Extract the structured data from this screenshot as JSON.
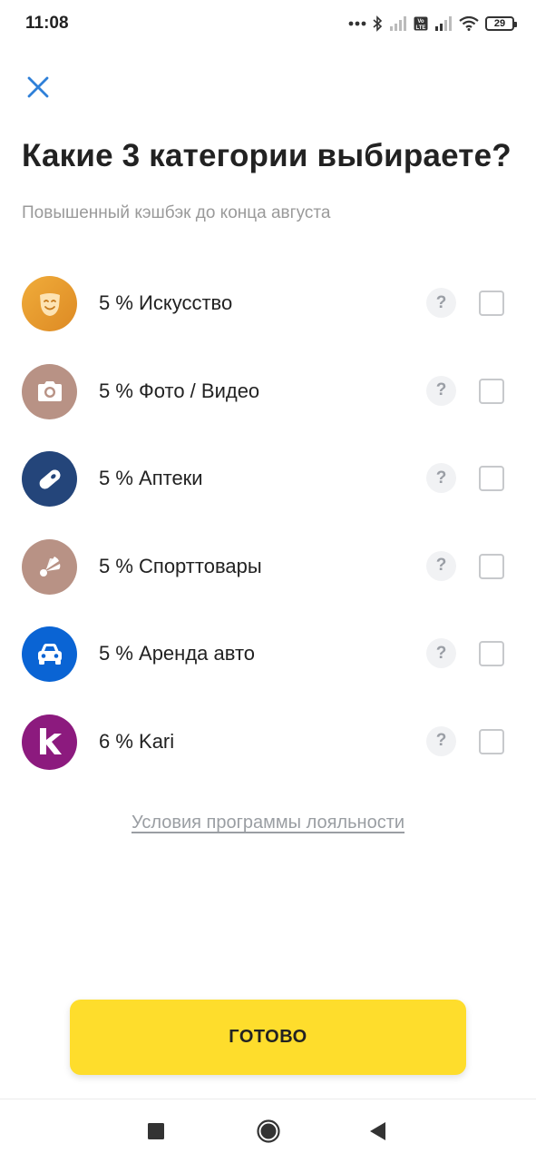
{
  "status_bar": {
    "time": "11:08",
    "battery": "29",
    "icons": [
      "dots-icon",
      "bluetooth-icon",
      "signal-icon",
      "volte-icon",
      "signal-icon",
      "wifi-icon",
      "battery-icon"
    ]
  },
  "header": {
    "close_icon": "close-icon",
    "title": "Какие 3 категории выбираете?",
    "subtitle": "Повышенный кэшбэк до конца августа"
  },
  "categories": [
    {
      "label": "5 % Искусство",
      "icon": "theater-mask-icon",
      "color": "#e59a2e",
      "help": "?"
    },
    {
      "label": "5 % Фото / Видео",
      "icon": "camera-icon",
      "color": "#b89285",
      "help": "?"
    },
    {
      "label": "5 % Аптеки",
      "icon": "pill-icon",
      "color": "#24457a",
      "help": "?"
    },
    {
      "label": "5 % Спорттовары",
      "icon": "shuttlecock-icon",
      "color": "#b89285",
      "help": "?"
    },
    {
      "label": "5 % Аренда авто",
      "icon": "car-icon",
      "color": "#0a64d4",
      "help": "?"
    },
    {
      "label": "6 % Kari",
      "icon": "kari-logo-icon",
      "color": "#8c1a7e",
      "help": "?"
    }
  ],
  "loyalty_link": "Условия программы лояльности",
  "done_button": "ГОТОВО",
  "colors": {
    "accent_blue": "#2f80d8",
    "button_yellow": "#fedd2c"
  },
  "nav": [
    "recent-apps-icon",
    "home-icon",
    "back-icon"
  ]
}
